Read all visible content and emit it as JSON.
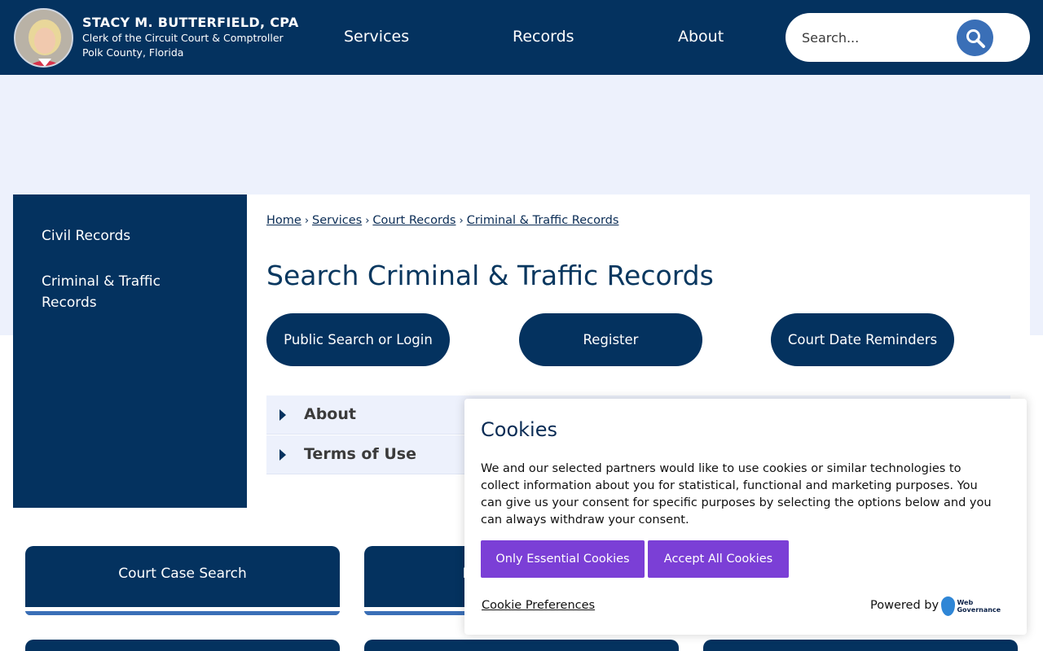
{
  "header": {
    "name": "STACY M. BUTTERFIELD, CPA",
    "subtitle": "Clerk of the Circuit Court & Comptroller",
    "county": "Polk County, Florida",
    "nav": [
      "Services",
      "Records",
      "About"
    ],
    "search_placeholder": "Search..."
  },
  "sidebar": {
    "items": [
      "Civil Records",
      "Criminal & Traffic Records"
    ]
  },
  "breadcrumb": [
    "Home",
    "Services",
    "Court Records",
    "Criminal & Traffic Records"
  ],
  "page_title": "Search Criminal & Traffic Records",
  "buttons": [
    "Public Search or Login",
    "Register",
    "Court Date Reminders"
  ],
  "accordion": [
    "About",
    "Terms of Use"
  ],
  "tiles": [
    "Court Case Search",
    "Property Records"
  ],
  "cookie": {
    "title": "Cookies",
    "text": "We and our selected partners would like to use cookies or similar technologies to collect information about you for statistical, functional and marketing purposes. You can give us your consent for specific purposes by selecting the options below and you can always withdraw your consent.",
    "essential_label": "Only Essential Cookies",
    "accept_label": "Accept All Cookies",
    "preferences_label": "Cookie Preferences",
    "powered_by": "Powered by",
    "logo_text": "Web Governance"
  },
  "colors": {
    "navy": "#04325f",
    "accent_blue": "#3a6fb7",
    "light_band": "#edf1fc",
    "cookie_button": "#7b3fd6"
  }
}
